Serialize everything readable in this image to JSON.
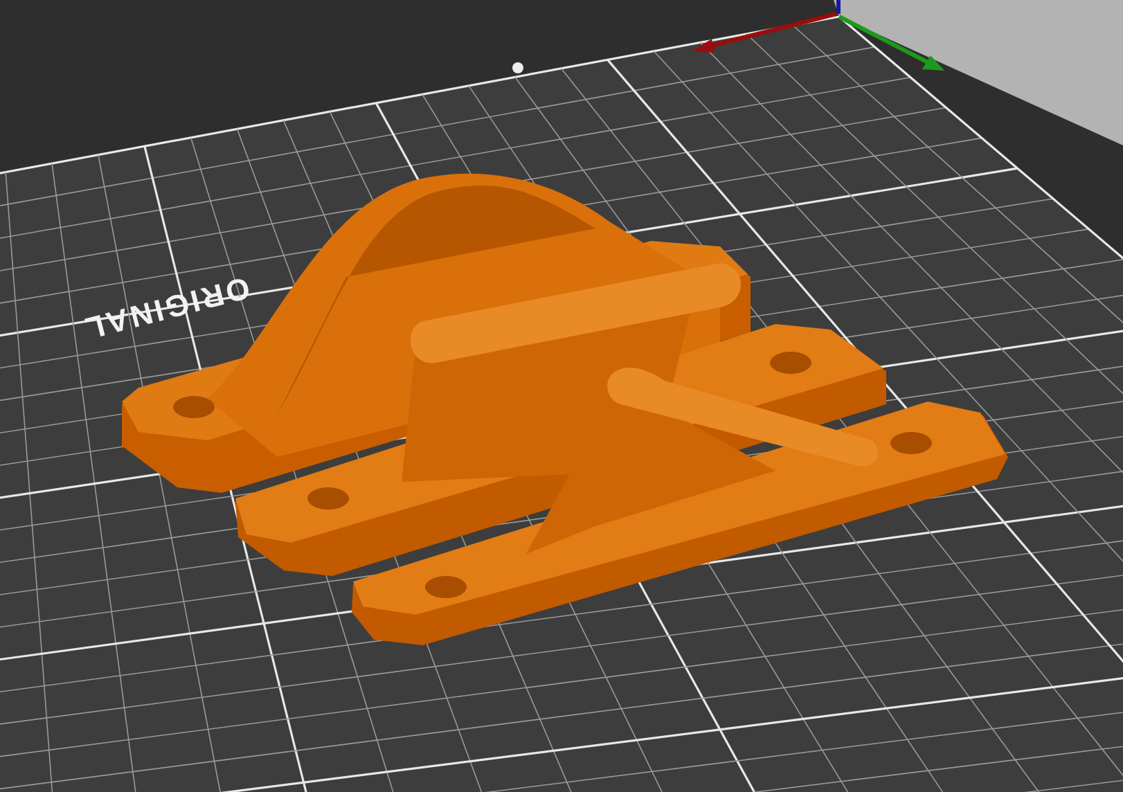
{
  "viewport": {
    "bed_label": "ORIGINAL"
  }
}
